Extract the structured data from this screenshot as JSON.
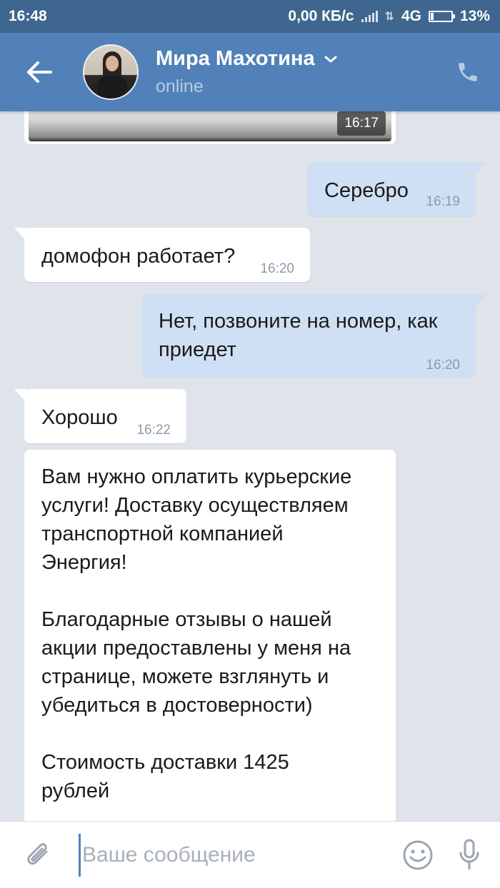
{
  "status_bar": {
    "time": "16:48",
    "speed": "0,00 КБ/с",
    "network": "4G",
    "battery": "13%",
    "battery_level": 0.13
  },
  "header": {
    "name": "Мира Махотина",
    "status": "online",
    "icons": [
      "back-arrow-icon",
      "chevron-down-icon",
      "phone-icon"
    ]
  },
  "messages": [
    {
      "dir": "in",
      "kind": "photo",
      "time": "16:17"
    },
    {
      "dir": "out",
      "text": "Серебро",
      "time": "16:19"
    },
    {
      "dir": "in",
      "text": "домофон работает?",
      "time": "16:20"
    },
    {
      "dir": "out",
      "line1": "Нет, позвоните на номер, как",
      "line2": "приедет",
      "time": "16:20"
    },
    {
      "dir": "in",
      "text": "Хорошо",
      "time": "16:22"
    },
    {
      "dir": "in",
      "p1": [
        "Вам нужно оплатить курьерские",
        "услуги! Доставку осуществляем",
        "транспортной компанией",
        "Энергия!"
      ],
      "p2": [
        "Благодарные отзывы о нашей",
        "акции предоставлены у меня на",
        "странице, можете взглянуть и",
        "убедиться в достоверности)"
      ],
      "p3": [
        "Стоимость доставки 1425",
        "рублей"
      ]
    }
  ],
  "input": {
    "placeholder": "Ваше сообщение",
    "icons": [
      "paperclip-icon",
      "emoji-icon",
      "microphone-icon"
    ]
  },
  "colors": {
    "status_bar": "#3e668f",
    "header": "#5181b8",
    "chat_bg": "#dfe4ea",
    "bubble_in": "#ffffff",
    "bubble_out": "#cfe0f5"
  }
}
